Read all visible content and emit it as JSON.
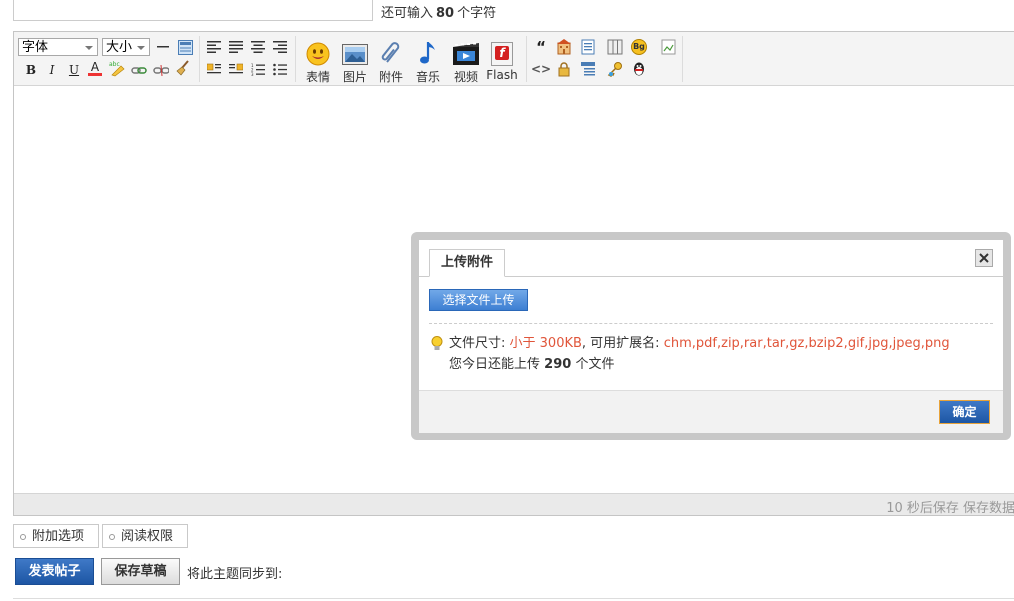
{
  "header": {
    "title_value": "",
    "counter_prefix": "还可输入",
    "counter_value": "80",
    "counter_suffix": "个字符"
  },
  "toolbar": {
    "font_select": "字体",
    "size_select": "大小",
    "bold": "B",
    "italic": "I",
    "underline": "U",
    "font_color": "A",
    "spell": "abc",
    "quote": "“",
    "code": "<>",
    "big_buttons": [
      {
        "icon": "smiley-icon",
        "label": "表情"
      },
      {
        "icon": "image-icon",
        "label": "图片"
      },
      {
        "icon": "paperclip-icon",
        "label": "附件"
      },
      {
        "icon": "music-note-icon",
        "label": "音乐"
      },
      {
        "icon": "video-icon",
        "label": "视频"
      },
      {
        "icon": "flash-icon",
        "label": "Flash"
      }
    ],
    "flash_letter": "f",
    "bg_badge": "Bg"
  },
  "status": {
    "save_text": "10 秒后保存 保存数据"
  },
  "dialog": {
    "tab_label": "上传附件",
    "upload_button": "选择文件上传",
    "size_label": "文件尺寸:",
    "size_value": "小于 300KB",
    "ext_label": ", 可用扩展名:",
    "ext_value": "chm,pdf,zip,rar,tar,gz,bzip2,gif,jpg,jpeg,png",
    "remaining_prefix": "您今日还能上传",
    "remaining_value": "290",
    "remaining_suffix": "个文件",
    "ok_button": "确定"
  },
  "options": {
    "extra": "附加选项",
    "permission": "阅读权限"
  },
  "actions": {
    "post": "发表帖子",
    "save_draft": "保存草稿",
    "sync_label": "将此主题同步到:"
  },
  "colors": {
    "accent_blue": "#1d56a4",
    "info_red": "#e0553a",
    "dialog_frame": "#c8c8c8"
  }
}
